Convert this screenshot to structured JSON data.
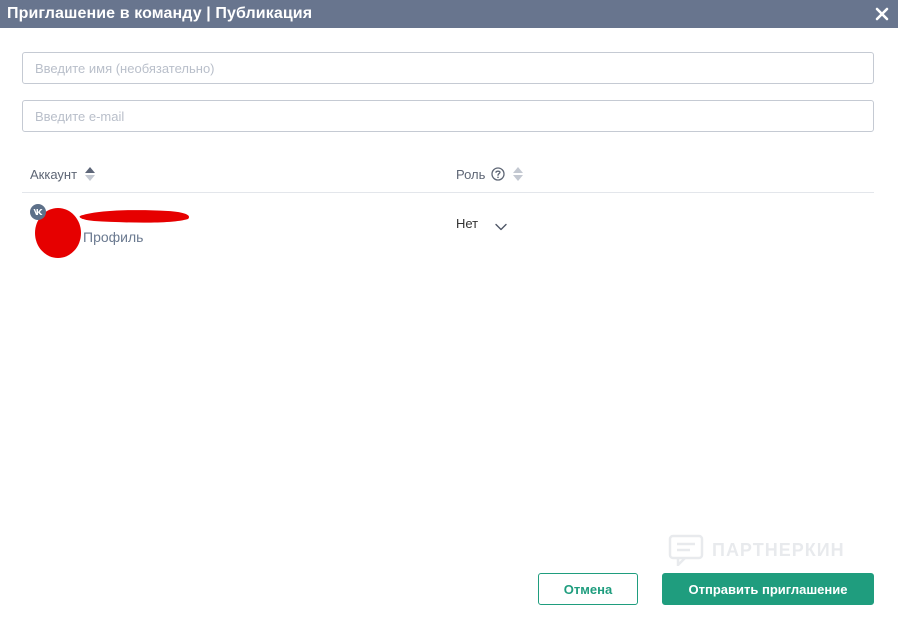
{
  "dialog": {
    "title": "Приглашение в команду | Публикация"
  },
  "form": {
    "name_placeholder": "Введите имя (необязательно)",
    "email_placeholder": "Введите e-mail"
  },
  "table": {
    "columns": {
      "account": "Аккаунт",
      "role": "Роль"
    },
    "rows": [
      {
        "network_badge": "vk",
        "profile_label": "Профиль",
        "role_value": "Нет"
      }
    ]
  },
  "watermark": {
    "text": "ПАРТНЕРКИН"
  },
  "buttons": {
    "cancel": "Отмена",
    "send": "Отправить приглашение"
  },
  "colors": {
    "titlebar": "#68758e",
    "accent": "#1f9d7e",
    "redaction": "#e60000"
  },
  "icons": {
    "close": "close-icon",
    "sort": "sort-icon",
    "help": "help-icon",
    "chevron": "chevron-down-icon",
    "vk": "vk-icon"
  }
}
